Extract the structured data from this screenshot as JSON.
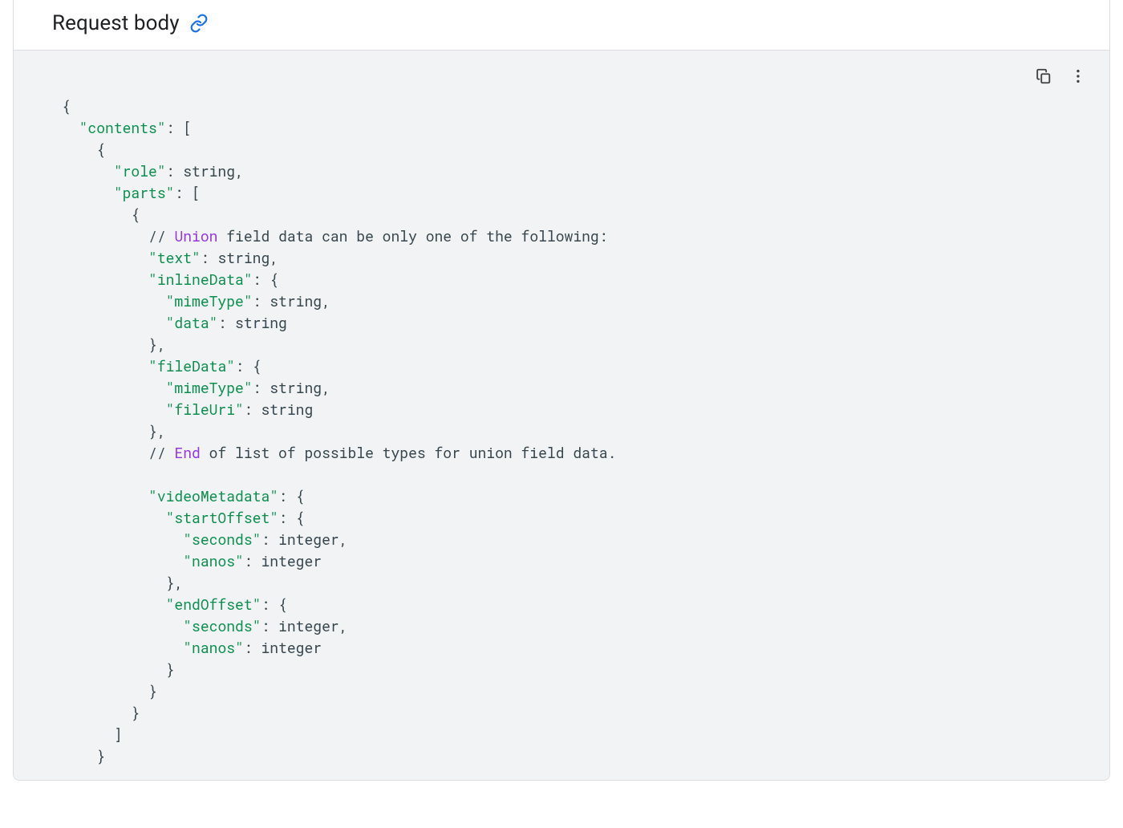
{
  "section": {
    "title": "Request body"
  },
  "code": {
    "tokens": [
      {
        "t": "{",
        "c": "plain"
      },
      {
        "t": "\n",
        "c": "plain"
      },
      {
        "t": "  ",
        "c": "plain"
      },
      {
        "t": "\"contents\"",
        "c": "str"
      },
      {
        "t": ": [",
        "c": "plain"
      },
      {
        "t": "\n",
        "c": "plain"
      },
      {
        "t": "    {",
        "c": "plain"
      },
      {
        "t": "\n",
        "c": "plain"
      },
      {
        "t": "      ",
        "c": "plain"
      },
      {
        "t": "\"role\"",
        "c": "str"
      },
      {
        "t": ": string,",
        "c": "plain"
      },
      {
        "t": "\n",
        "c": "plain"
      },
      {
        "t": "      ",
        "c": "plain"
      },
      {
        "t": "\"parts\"",
        "c": "str"
      },
      {
        "t": ": [",
        "c": "plain"
      },
      {
        "t": "\n",
        "c": "plain"
      },
      {
        "t": "        {",
        "c": "plain"
      },
      {
        "t": "\n",
        "c": "plain"
      },
      {
        "t": "          // ",
        "c": "comment"
      },
      {
        "t": "Union",
        "c": "kw"
      },
      {
        "t": " field data can be only one of the following:",
        "c": "comment"
      },
      {
        "t": "\n",
        "c": "plain"
      },
      {
        "t": "          ",
        "c": "plain"
      },
      {
        "t": "\"text\"",
        "c": "str"
      },
      {
        "t": ": string,",
        "c": "plain"
      },
      {
        "t": "\n",
        "c": "plain"
      },
      {
        "t": "          ",
        "c": "plain"
      },
      {
        "t": "\"inlineData\"",
        "c": "str"
      },
      {
        "t": ": {",
        "c": "plain"
      },
      {
        "t": "\n",
        "c": "plain"
      },
      {
        "t": "            ",
        "c": "plain"
      },
      {
        "t": "\"mimeType\"",
        "c": "str"
      },
      {
        "t": ": string,",
        "c": "plain"
      },
      {
        "t": "\n",
        "c": "plain"
      },
      {
        "t": "            ",
        "c": "plain"
      },
      {
        "t": "\"data\"",
        "c": "str"
      },
      {
        "t": ": string",
        "c": "plain"
      },
      {
        "t": "\n",
        "c": "plain"
      },
      {
        "t": "          },",
        "c": "plain"
      },
      {
        "t": "\n",
        "c": "plain"
      },
      {
        "t": "          ",
        "c": "plain"
      },
      {
        "t": "\"fileData\"",
        "c": "str"
      },
      {
        "t": ": {",
        "c": "plain"
      },
      {
        "t": "\n",
        "c": "plain"
      },
      {
        "t": "            ",
        "c": "plain"
      },
      {
        "t": "\"mimeType\"",
        "c": "str"
      },
      {
        "t": ": string,",
        "c": "plain"
      },
      {
        "t": "\n",
        "c": "plain"
      },
      {
        "t": "            ",
        "c": "plain"
      },
      {
        "t": "\"fileUri\"",
        "c": "str"
      },
      {
        "t": ": string",
        "c": "plain"
      },
      {
        "t": "\n",
        "c": "plain"
      },
      {
        "t": "          },",
        "c": "plain"
      },
      {
        "t": "\n",
        "c": "plain"
      },
      {
        "t": "          // ",
        "c": "comment"
      },
      {
        "t": "End",
        "c": "kw"
      },
      {
        "t": " of list of possible types for union field data.",
        "c": "comment"
      },
      {
        "t": "\n",
        "c": "plain"
      },
      {
        "t": "\n",
        "c": "plain"
      },
      {
        "t": "          ",
        "c": "plain"
      },
      {
        "t": "\"videoMetadata\"",
        "c": "str"
      },
      {
        "t": ": {",
        "c": "plain"
      },
      {
        "t": "\n",
        "c": "plain"
      },
      {
        "t": "            ",
        "c": "plain"
      },
      {
        "t": "\"startOffset\"",
        "c": "str"
      },
      {
        "t": ": {",
        "c": "plain"
      },
      {
        "t": "\n",
        "c": "plain"
      },
      {
        "t": "              ",
        "c": "plain"
      },
      {
        "t": "\"seconds\"",
        "c": "str"
      },
      {
        "t": ": integer,",
        "c": "plain"
      },
      {
        "t": "\n",
        "c": "plain"
      },
      {
        "t": "              ",
        "c": "plain"
      },
      {
        "t": "\"nanos\"",
        "c": "str"
      },
      {
        "t": ": integer",
        "c": "plain"
      },
      {
        "t": "\n",
        "c": "plain"
      },
      {
        "t": "            },",
        "c": "plain"
      },
      {
        "t": "\n",
        "c": "plain"
      },
      {
        "t": "            ",
        "c": "plain"
      },
      {
        "t": "\"endOffset\"",
        "c": "str"
      },
      {
        "t": ": {",
        "c": "plain"
      },
      {
        "t": "\n",
        "c": "plain"
      },
      {
        "t": "              ",
        "c": "plain"
      },
      {
        "t": "\"seconds\"",
        "c": "str"
      },
      {
        "t": ": integer,",
        "c": "plain"
      },
      {
        "t": "\n",
        "c": "plain"
      },
      {
        "t": "              ",
        "c": "plain"
      },
      {
        "t": "\"nanos\"",
        "c": "str"
      },
      {
        "t": ": integer",
        "c": "plain"
      },
      {
        "t": "\n",
        "c": "plain"
      },
      {
        "t": "            }",
        "c": "plain"
      },
      {
        "t": "\n",
        "c": "plain"
      },
      {
        "t": "          }",
        "c": "plain"
      },
      {
        "t": "\n",
        "c": "plain"
      },
      {
        "t": "        }",
        "c": "plain"
      },
      {
        "t": "\n",
        "c": "plain"
      },
      {
        "t": "      ]",
        "c": "plain"
      },
      {
        "t": "\n",
        "c": "plain"
      },
      {
        "t": "    }",
        "c": "plain"
      }
    ]
  }
}
